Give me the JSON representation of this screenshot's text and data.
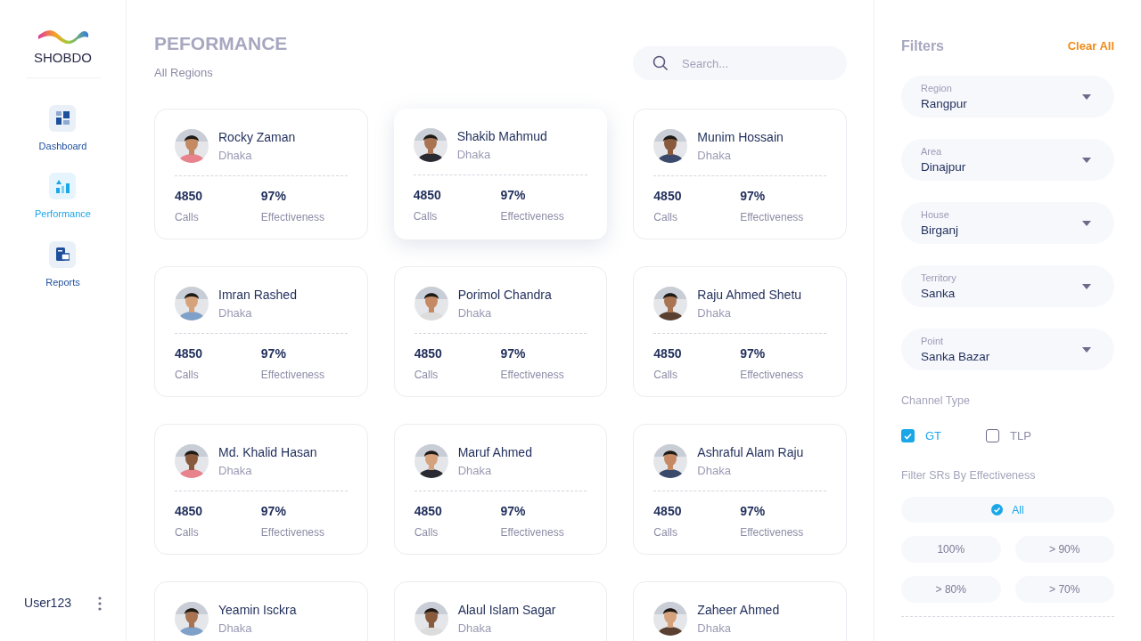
{
  "sidebar": {
    "logo": "SHOBDO",
    "items": [
      {
        "label": "Dashboard",
        "selected": false
      },
      {
        "label": "Performance",
        "selected": true
      },
      {
        "label": "Reports",
        "selected": false
      }
    ],
    "user": "User123"
  },
  "header": {
    "title": "PEFORMANCE",
    "subtitle": "All Regions",
    "search": {
      "placeholder": "Search..."
    }
  },
  "cards": [
    {
      "name": "Rocky Zaman",
      "location": "Dhaka",
      "calls": "4850",
      "calls_label": "Calls",
      "effectiveness": "97%",
      "effectiveness_label": "Effectiveness",
      "selected": false
    },
    {
      "name": "Shakib Mahmud",
      "location": "Dhaka",
      "calls": "4850",
      "calls_label": "Calls",
      "effectiveness": "97%",
      "effectiveness_label": "Effectiveness",
      "selected": true
    },
    {
      "name": "Munim Hossain",
      "location": "Dhaka",
      "calls": "4850",
      "calls_label": "Calls",
      "effectiveness": "97%",
      "effectiveness_label": "Effectiveness",
      "selected": false
    },
    {
      "name": "Imran Rashed",
      "location": "Dhaka",
      "calls": "4850",
      "calls_label": "Calls",
      "effectiveness": "97%",
      "effectiveness_label": "Effectiveness",
      "selected": false
    },
    {
      "name": "Porimol Chandra",
      "location": "Dhaka",
      "calls": "4850",
      "calls_label": "Calls",
      "effectiveness": "97%",
      "effectiveness_label": "Effectiveness",
      "selected": false
    },
    {
      "name": "Raju Ahmed Shetu",
      "location": "Dhaka",
      "calls": "4850",
      "calls_label": "Calls",
      "effectiveness": "97%",
      "effectiveness_label": "Effectiveness",
      "selected": false
    },
    {
      "name": "Md. Khalid Hasan",
      "location": "Dhaka",
      "calls": "4850",
      "calls_label": "Calls",
      "effectiveness": "97%",
      "effectiveness_label": "Effectiveness",
      "selected": false
    },
    {
      "name": "Maruf Ahmed",
      "location": "Dhaka",
      "calls": "4850",
      "calls_label": "Calls",
      "effectiveness": "97%",
      "effectiveness_label": "Effectiveness",
      "selected": false
    },
    {
      "name": "Ashraful Alam Raju",
      "location": "Dhaka",
      "calls": "4850",
      "calls_label": "Calls",
      "effectiveness": "97%",
      "effectiveness_label": "Effectiveness",
      "selected": false
    },
    {
      "name": "Yeamin Isckra",
      "location": "Dhaka",
      "selected": false
    },
    {
      "name": "Alaul Islam Sagar",
      "location": "Dhaka",
      "selected": false
    },
    {
      "name": "Zaheer Ahmed",
      "location": "Dhaka",
      "selected": false
    }
  ],
  "filters": {
    "title": "Filters",
    "clear": "Clear All",
    "dropdowns": [
      {
        "label": "Region",
        "value": "Rangpur"
      },
      {
        "label": "Area",
        "value": "Dinajpur"
      },
      {
        "label": "House",
        "value": "Birganj"
      },
      {
        "label": "Territory",
        "value": "Sanka"
      },
      {
        "label": "Point",
        "value": "Sanka Bazar"
      }
    ],
    "channel_title": "Channel Type",
    "channels": [
      {
        "label": "GT",
        "checked": true
      },
      {
        "label": "TLP",
        "checked": false
      }
    ],
    "effectiveness_title": "Filter SRs By Effectiveness",
    "effectiveness_options": [
      {
        "label": "All",
        "selected": true
      },
      {
        "label": "100%",
        "selected": false
      },
      {
        "label": "> 90%",
        "selected": false
      },
      {
        "label": "> 80%",
        "selected": false
      },
      {
        "label": "> 70%",
        "selected": false
      }
    ]
  }
}
